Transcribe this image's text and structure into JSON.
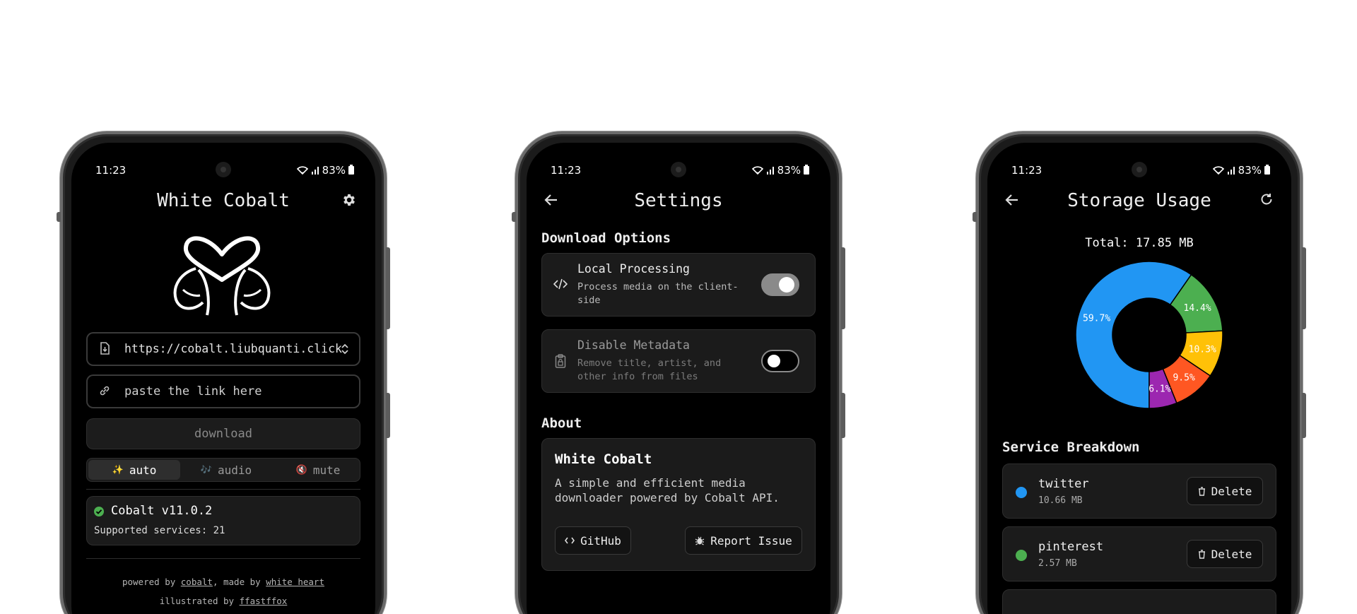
{
  "status": {
    "time": "11:23",
    "battery": "83%"
  },
  "home": {
    "title": "White Cobalt",
    "instance_url": "https://cobalt.liubquanti.click",
    "link_placeholder": "paste the link here",
    "download_label": "download",
    "modes": [
      {
        "emoji": "✨",
        "label": "auto"
      },
      {
        "emoji": "🎶",
        "label": "audio"
      },
      {
        "emoji": "🔇",
        "label": "mute"
      }
    ],
    "version": "Cobalt v11.0.2",
    "supported": "Supported services: 21",
    "footer": {
      "powered_by": "powered by ",
      "cobalt_link": "cobalt",
      "made_by": ", made by ",
      "author_link": "white heart",
      "illustrated_by": "illustrated by ",
      "illustrator_link": "ffastffox"
    }
  },
  "settings": {
    "title": "Settings",
    "download_options_title": "Download Options",
    "local_processing": {
      "title": "Local Processing",
      "desc": "Process media on the client-side"
    },
    "disable_metadata": {
      "title": "Disable Metadata",
      "desc": "Remove title, artist, and other info from files"
    },
    "about_title": "About",
    "about": {
      "name": "White Cobalt",
      "desc": "A simple and efficient media downloader powered by Cobalt API.",
      "github_label": "GitHub",
      "report_label": "Report Issue"
    }
  },
  "storage": {
    "title": "Storage Usage",
    "total": "Total: 17.85 MB",
    "breakdown_title": "Service Breakdown",
    "services": [
      {
        "name": "twitter",
        "size": "10.66 MB",
        "color": "#2196F3"
      },
      {
        "name": "pinterest",
        "size": "2.57 MB",
        "color": "#4CAF50"
      }
    ],
    "delete_label": "Delete"
  },
  "chart_data": {
    "type": "pie",
    "values": [
      59.7,
      14.4,
      10.3,
      9.5,
      6.1
    ],
    "labels": [
      "59.7%",
      "14.4%",
      "10.3%",
      "9.5%",
      "6.1%"
    ],
    "colors": [
      "#2196F3",
      "#4CAF50",
      "#FFC107",
      "#FF5722",
      "#9C27B0"
    ],
    "start_deg": 90
  },
  "colors": {
    "accent_green": "#4CAF50",
    "background": "#000000",
    "card": "#1b1b1b"
  }
}
